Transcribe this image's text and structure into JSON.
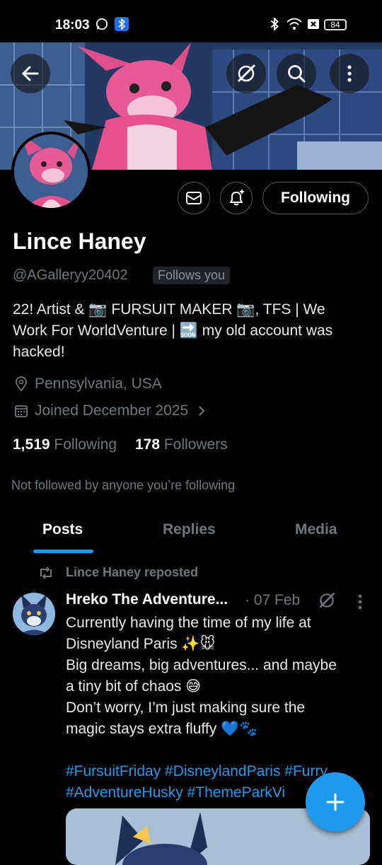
{
  "status_bar": {
    "time": "18:03",
    "battery": "84"
  },
  "profile": {
    "name": "Lince Haney",
    "handle": "@AGalleryy20402",
    "follows_you": "Follows you",
    "bio_lines": [
      "22! Artist & 📷 FURSUIT MAKER 📷, TFS | We",
      "Work For WorldVenture | 🔜 my old account was",
      "hacked!"
    ],
    "location": "Pennsylvania, USA",
    "joined": "Joined December 2025",
    "following_count": "1,519",
    "following_label": "Following",
    "followers_count": "178",
    "followers_label": "Followers",
    "not_followed": "Not followed by anyone you’re following",
    "following_button": "Following"
  },
  "tabs": [
    "Posts",
    "Replies",
    "Media"
  ],
  "post": {
    "reposted_by": "Lince Haney reposted",
    "author": "Hreko The Adventure...",
    "date": "· 07 Feb",
    "body_lines": [
      "Currently having the time of my life at",
      "Disneyland Paris ✨🐭",
      "Big dreams, big adventures... and maybe",
      "a tiny bit of chaos 😅",
      "Don’t worry, I’m just making sure the",
      "magic stays extra fluffy 💙🐾"
    ],
    "hashtags_line1": "#FursuitFriday #DisneylandParis #Furry",
    "hashtags_line2": "#AdventureHusky #ThemeParkVi"
  },
  "icons": {
    "back": "back-arrow-icon",
    "grok": "grok-icon",
    "search": "search-icon",
    "more": "more-vertical-icon",
    "message": "message-icon",
    "notify": "bell-plus-icon",
    "location": "location-pin-icon",
    "calendar": "calendar-icon",
    "repost": "repost-icon",
    "compose": "plus-icon"
  },
  "colors": {
    "accent": "#1d9bf0",
    "background": "#000000",
    "muted": "#71767b"
  }
}
